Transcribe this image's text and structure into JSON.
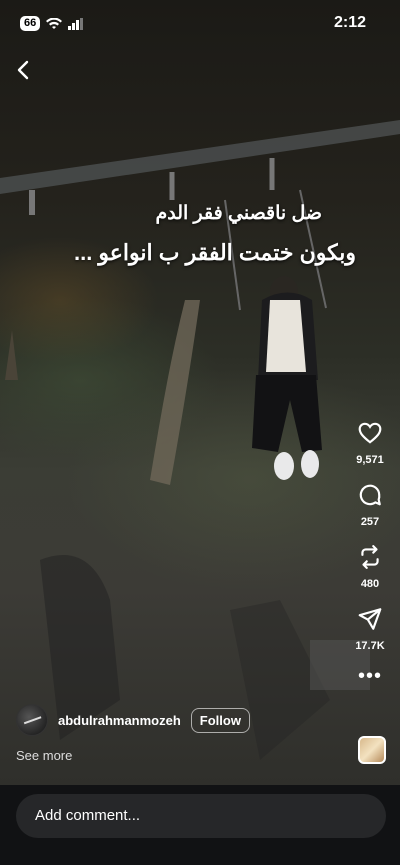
{
  "status_bar": {
    "battery": "66",
    "time": "2:12"
  },
  "caption": {
    "line1": "ضل ناقصني فقر الدم",
    "line2": "وبكون ختمت الفقر ب انواعو ..."
  },
  "actions": {
    "likes": {
      "icon": "heart-icon",
      "count": "9,571"
    },
    "comments": {
      "icon": "comment-icon",
      "count": "257"
    },
    "reposts": {
      "icon": "repost-icon",
      "count": "480"
    },
    "shares": {
      "icon": "send-icon",
      "count": "17.7K"
    },
    "more": {
      "icon": "more-icon",
      "label": "•••"
    }
  },
  "user": {
    "username": "abdulrahmanmozeh",
    "follow_label": "Follow"
  },
  "description": {
    "see_more": "See more"
  },
  "comment_bar": {
    "placeholder": "Add comment..."
  }
}
